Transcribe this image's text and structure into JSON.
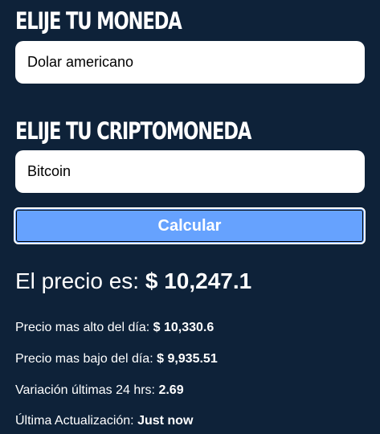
{
  "form": {
    "currency_heading": "Elije tu Moneda",
    "currency_selected": "Dolar americano",
    "crypto_heading": "Elije tu Criptomoneda",
    "crypto_selected": "Bitcoin",
    "calculate_label": "Calcular"
  },
  "result": {
    "price_label": "El precio es: ",
    "price_value": "$ 10,247.1",
    "high_label": "Precio mas alto del día: ",
    "high_value": "$ 10,330.6",
    "low_label": "Precio mas bajo del día: ",
    "low_value": "$ 9,935.51",
    "change_label": "Variación últimas 24 hrs: ",
    "change_value": "2.69",
    "updated_label": "Última Actualización: ",
    "updated_value": "Just now"
  },
  "colors": {
    "background": "#0e2239",
    "button": "#66a2fe",
    "text": "#ffffff"
  }
}
